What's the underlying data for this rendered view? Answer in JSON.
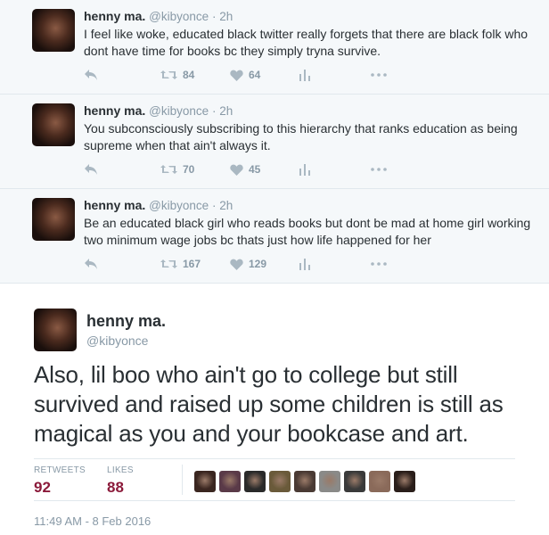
{
  "thread": [
    {
      "name": "henny ma.",
      "handle": "@kibyonce",
      "time": "· 2h",
      "text": "I feel like woke, educated black twitter really forgets that there are black folk who dont have time for books bc they simply tryna survive.",
      "retweets": "84",
      "likes": "64"
    },
    {
      "name": "henny ma.",
      "handle": "@kibyonce",
      "time": "· 2h",
      "text": "You subconsciously subscribing to this hierarchy that ranks education as being supreme when that ain't always it.",
      "retweets": "70",
      "likes": "45"
    },
    {
      "name": "henny ma.",
      "handle": "@kibyonce",
      "time": "· 2h",
      "text": "Be an educated black girl who reads books but dont be mad at home girl working two minimum wage jobs bc thats just how life happened for her",
      "retweets": "167",
      "likes": "129"
    }
  ],
  "main_tweet": {
    "name": "henny ma.",
    "handle": "@kibyonce",
    "text": "Also, lil boo who ain't go to college but still survived and raised up some children is still as magical as you and your bookcase and art.",
    "retweets_label": "RETWEETS",
    "retweets": "92",
    "likes_label": "LIKES",
    "likes": "88",
    "timestamp": "11:49 AM - 8 Feb 2016"
  },
  "icons": {
    "reply": "reply-icon",
    "retweet": "retweet-icon",
    "like": "heart-icon",
    "analytics": "analytics-icon",
    "more": "more-icon"
  },
  "colors": {
    "thread_bg": "#f5f8fa",
    "muted": "#8899a6",
    "count_accent": "#8b1a3a"
  },
  "liker_colors": [
    "#3a2620",
    "#5a3a48",
    "#2a2a2a",
    "#6a5a3a",
    "#4a3a34",
    "#8a8a88",
    "#3a3a3a",
    "#8a6a5a",
    "#2a1e1a"
  ]
}
